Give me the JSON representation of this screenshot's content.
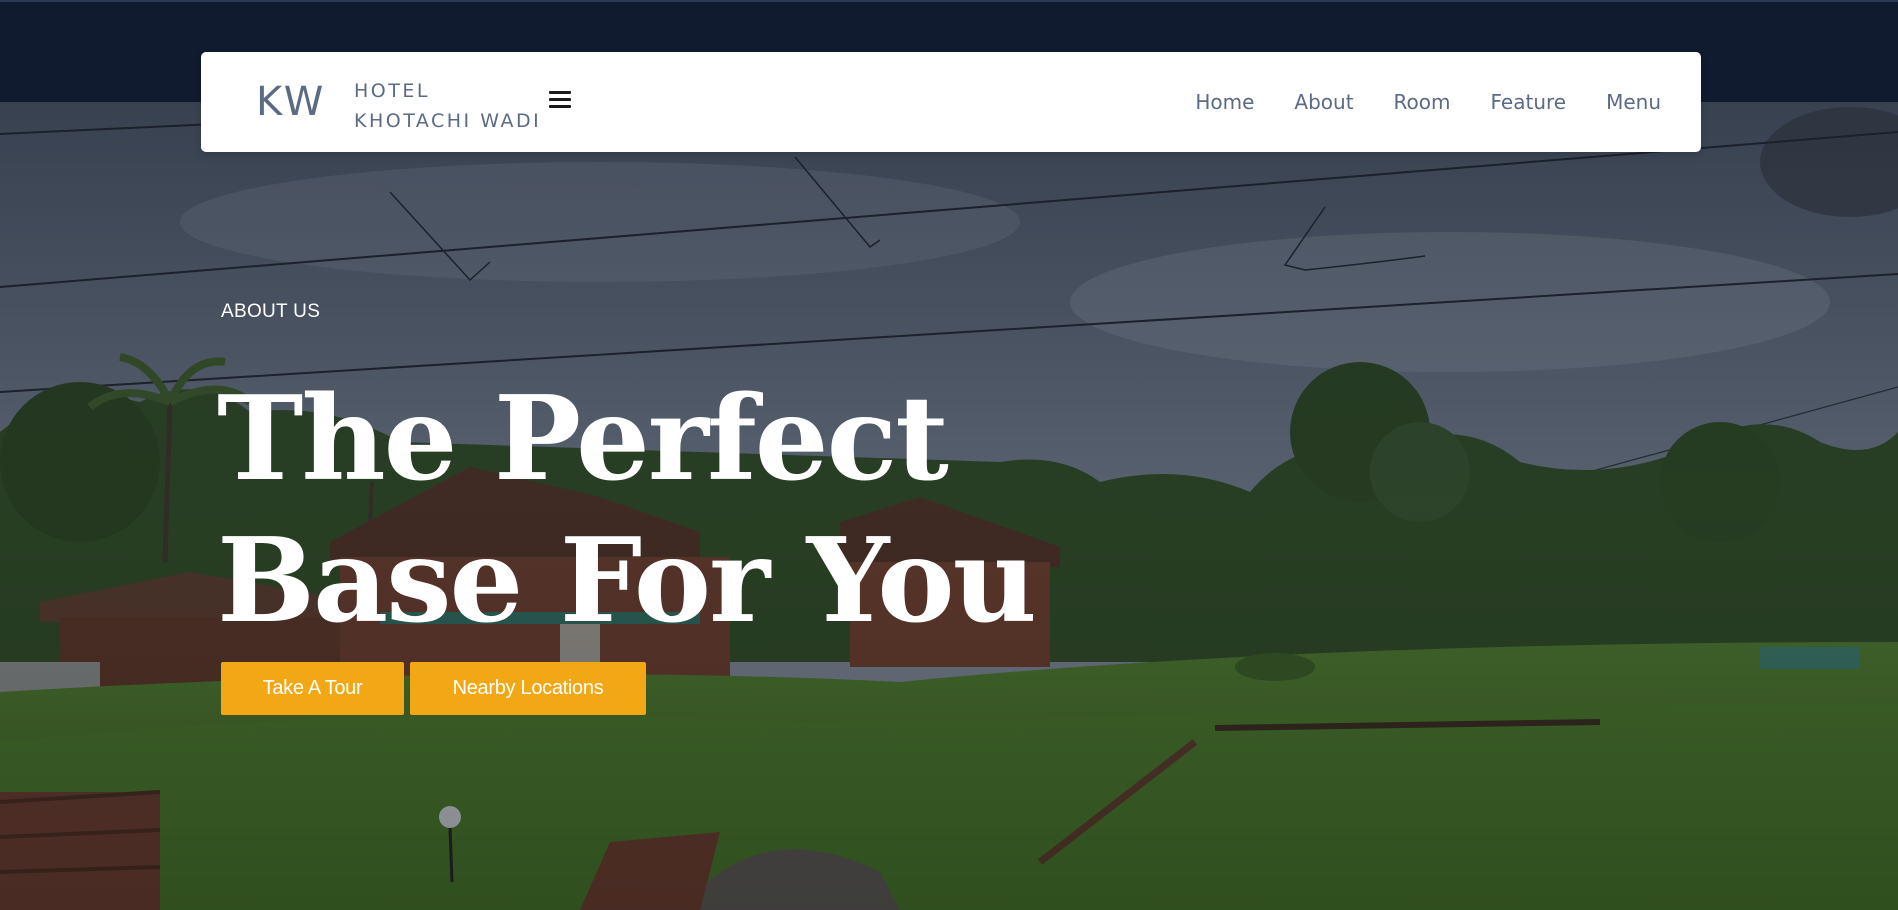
{
  "brand": {
    "mark": "KW",
    "line1": "HOTEL",
    "line2": "KHOTACHI WADI"
  },
  "nav": {
    "menu_icon": "hamburger-menu-icon",
    "items": [
      {
        "label": "Home"
      },
      {
        "label": "About"
      },
      {
        "label": "Room"
      },
      {
        "label": "Feature"
      },
      {
        "label": "Menu"
      }
    ]
  },
  "hero": {
    "eyebrow": "ABOUT US",
    "headline_line1": "The Perfect",
    "headline_line2": "Base For You",
    "buttons": {
      "tour": "Take A Tour",
      "nearby": "Nearby Locations"
    }
  },
  "colors": {
    "accent": "#f2a714",
    "top_band": "#101b30",
    "nav_text": "#5b6b85",
    "nav_bg": "#ffffff"
  }
}
